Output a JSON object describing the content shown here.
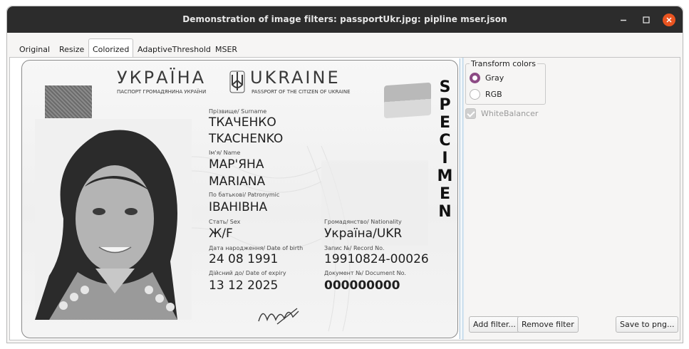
{
  "window": {
    "title": "Demonstration of image filters: passportUkr.jpg: pipline mser.json"
  },
  "tabs": [
    {
      "label": "Original"
    },
    {
      "label": "Resize"
    },
    {
      "label": "Colorized"
    },
    {
      "label": "AdaptiveThreshold"
    },
    {
      "label": "MSER"
    }
  ],
  "active_tab": "Colorized",
  "passport": {
    "header_ua": "УКРАЇНА",
    "header_en": "UKRAINE",
    "subtitle_ua": "ПАСПОРТ ГРОМАДЯНИНА УКРАЇНИ",
    "subtitle_en": "PASSPORT OF THE CITIZEN OF UKRAINE",
    "specimen": "SPECIMEN",
    "surname_label": "Прізвище/ Surname",
    "surname_ua": "ТКАЧЕНКО",
    "surname_en": "TKACHENKO",
    "name_label": "Ім'я/ Name",
    "name_ua": "МАР'ЯНА",
    "name_en": "MARIANA",
    "patronymic_label": "По батькові/ Patronymic",
    "patronymic": "ІВАНІВНА",
    "sex_label": "Стать/ Sex",
    "sex": "Ж/F",
    "nationality_label": "Громадянство/ Nationality",
    "nationality": "Україна/UKR",
    "dob_label": "Дата народження/ Date of birth",
    "dob": "24 08 1991",
    "record_label": "Запис №/ Record No.",
    "record": "19910824-00026",
    "expiry_label": "Дійсний до/ Date of expiry",
    "expiry": "13 12 2025",
    "docno_label": "Документ №/ Document No.",
    "docno": "000000000",
    "signature": "Mф"
  },
  "controls": {
    "transform_group_title": "Transform colors",
    "options": [
      {
        "label": "Gray",
        "selected": true
      },
      {
        "label": "RGB",
        "selected": false
      }
    ],
    "white_balancer_label": "WhiteBalancer",
    "white_balancer_checked": true,
    "add_filter_label": "Add filter...",
    "remove_filter_label": "Remove filter",
    "save_label": "Save to png..."
  },
  "colors": {
    "titlebar": "#2c2c2c",
    "close_button": "#e95420",
    "radio_selected": "#8c4a84"
  }
}
